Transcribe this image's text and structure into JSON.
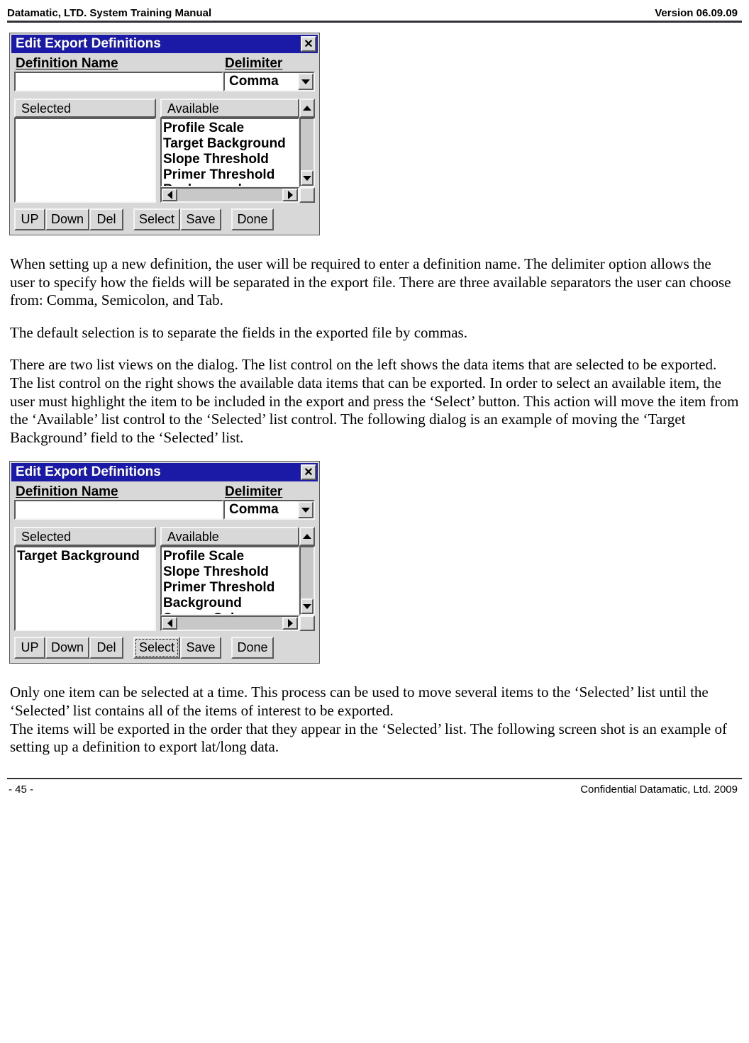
{
  "header": {
    "left": "Datamatic, LTD. System Training  Manual",
    "right": "Version 06.09.09"
  },
  "footer": {
    "left": "- 45 -",
    "right": "Confidential Datamatic, Ltd. 2009"
  },
  "dialog1": {
    "title": "Edit Export Definitions",
    "defname_label": "Definition Name",
    "defname_value": "",
    "delimiter_label": "Delimiter",
    "delimiter_value": "Comma",
    "selected_header": "Selected",
    "available_header": "Available",
    "selected_items": [],
    "available_items": [
      "Profile Scale",
      "Target Background",
      "Slope Threshold",
      "Primer Threshold",
      "Background"
    ],
    "buttons": {
      "up": "UP",
      "down": "Down",
      "del": "Del",
      "select": "Select",
      "save": "Save",
      "done": "Done"
    }
  },
  "para1": "When setting up a new definition, the user will be required to enter a definition name.  The delimiter option allows the user to specify how the fields will be separated in the export file.  There are three available separators the user can choose from: Comma, Semicolon, and Tab.",
  "para2": "The default selection is to separate the fields in the exported file by commas.",
  "para3": "There are two list views on the dialog.  The list control on the left shows the data items that are selected to be exported.  The list control on the right shows the available data items that can be exported.  In order to select an available item, the user must highlight the item to be included in the export and press the ‘Select’ button.  This action will move the item from the ‘Available’ list control to the ‘Selected’ list control.  The following dialog is an example of moving the ‘Target Background’ field to the ‘Selected’ list.",
  "dialog2": {
    "title": "Edit Export Definitions",
    "defname_label": "Definition Name",
    "defname_value": "",
    "delimiter_label": "Delimiter",
    "delimiter_value": "Comma",
    "selected_header": "Selected",
    "available_header": "Available",
    "selected_items": [
      "Target Background"
    ],
    "available_items": [
      "Profile Scale",
      "Slope Threshold",
      "Primer Threshold",
      "Background",
      "Sensor Gain"
    ],
    "buttons": {
      "up": "UP",
      "down": "Down",
      "del": "Del",
      "select": "Select",
      "save": "Save",
      "done": "Done"
    }
  },
  "para4": "Only one item can be selected at a time.  This process can be used to move several items to the ‘Selected’ list until the ‘Selected’ list contains all of the items of interest to be exported.",
  "para5": "The items will be exported in the order that they appear in the ‘Selected’ list.  The following screen shot is an example of setting up a definition to export lat/long data."
}
